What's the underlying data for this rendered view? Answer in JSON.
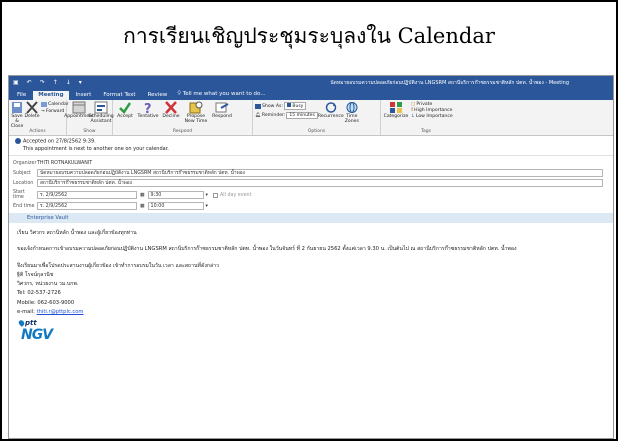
{
  "slide": {
    "title": "การเรียนเชิญประชุมระบุลงใน Calendar"
  },
  "window": {
    "title": "นัดหมายอบรมความปลอดภัยก่อนปฏิบัติงาน LNGSRM สถานีบริการก๊าซธรรมชาติหลัก ปตท. น้ำพอง - Meeting"
  },
  "tabs": [
    {
      "label": "File"
    },
    {
      "label": "Meeting"
    },
    {
      "label": "Insert"
    },
    {
      "label": "Format Text"
    },
    {
      "label": "Review"
    }
  ],
  "tell_me": "Tell me what you want to do...",
  "ribbon": {
    "actions": {
      "label": "Actions",
      "save_close": "Save & Close",
      "delete": "Delete",
      "calendar": "Calendar",
      "forward": "Forward"
    },
    "show": {
      "label": "Show",
      "appointment": "Appointment",
      "scheduling": "Scheduling Assistant"
    },
    "respond": {
      "label": "Respond",
      "accept": "Accept",
      "tentative": "Tentative",
      "decline": "Decline",
      "propose": "Propose New Time",
      "respond": "Respond"
    },
    "options": {
      "label": "Options",
      "show_as": "Show As:",
      "show_as_value": "Busy",
      "reminder": "Reminder:",
      "reminder_value": "15 minutes",
      "recurrence": "Recurrence",
      "time_zones": "Time Zones"
    },
    "tags": {
      "label": "Tags",
      "categorize": "Categorize",
      "private": "Private",
      "high": "High Importance",
      "low": "Low Importance"
    }
  },
  "info": {
    "accepted": "Accepted on 27/8/2562 9:39.",
    "note": "This appointment is next to another one on your calendar."
  },
  "fields": {
    "organizer_label": "Organizer",
    "organizer": "THITI ROTNAKULWANIT",
    "subject_label": "Subject",
    "subject": "นัดหมายอบรมความปลอดภัยก่อนปฏิบัติงาน LNGSRM สถานีบริการก๊าซธรรมชาติหลัก ปตท. น้ำพอง",
    "location_label": "Location",
    "location": "สถานีบริการก๊าซธรรมชาติหลัก ปตท. น้ำพอง",
    "start_label": "Start time",
    "start_date": "ร. 2/9/2562",
    "start_time": "9:30",
    "allday": "All day event",
    "end_label": "End time",
    "end_date": "ร. 2/9/2562",
    "end_time": "10:00"
  },
  "enterprise_vault": "Enterprise Vault",
  "body": {
    "greeting": "เรียน วิศวกร สถานีหลัก น้ำพอง และผู้เกี่ยวข้องทุกท่าน",
    "line1": "ขอแจ้งกำหนดการเข้าอบรมความปลอดภัยก่อนปฏิบัติงาน LNGSRM สถานีบริการก๊าซธรรมชาติหลัก ปตท. น้ำพอง ในวันจันทร์ ที่ 2 กันยายน 2562 ตั้งแต่เวลา 9.30 น. เป็นต้นไป ณ สถานีบริการก๊าซธรรมชาติหลัก ปตท. น้ำพอง",
    "line2": "จึงเรียนมาเพื่อโปรดประสานงานผู้เกี่ยวข้อง เข้าทำการอบรมในวัน เวลา และสถานที่ดังกล่าว",
    "name": "ฐิติ โรจน์กุลวนิช",
    "position": "วิศวกร, หน่วยงาน วม.บกพ.",
    "tel": "Tel: 02-537-2726",
    "mobile": "Mobile: 062-603-9000",
    "email_label": "e-mail:",
    "email": "thiti.r@pttplc.com"
  },
  "logo": {
    "top": "ptt",
    "bottom": "NGV"
  },
  "colors": {
    "ribbon_blue": "#2b579a",
    "check_green": "#2e9e46",
    "decline_red": "#d13438"
  }
}
